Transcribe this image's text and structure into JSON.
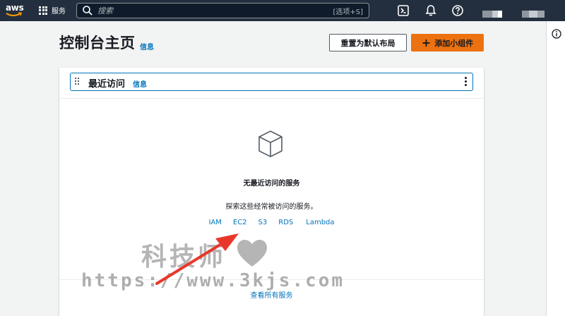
{
  "nav": {
    "logo_text": "aws",
    "services_label": "服务",
    "search_placeholder": "搜索",
    "search_shortcut": "[选项+S]"
  },
  "page": {
    "title": "控制台主页",
    "info": "信息",
    "reset_button": "重置为默认布局",
    "add_widget_button": "添加小组件"
  },
  "widget": {
    "title": "最近访问",
    "info": "信息",
    "empty_title": "无最近访问的服务",
    "empty_description": "探索这些经常被访问的服务。",
    "services": [
      "IAM",
      "EC2",
      "S3",
      "RDS",
      "Lambda"
    ],
    "view_all": "查看所有服务"
  },
  "watermark": {
    "text": "科技师",
    "url": "https://www.3kjs.com"
  },
  "colors": {
    "nav_bg": "#232f3e",
    "accent_orange": "#ec7211",
    "link_blue": "#0073bb",
    "annotation_arrow": "#e8372a"
  }
}
